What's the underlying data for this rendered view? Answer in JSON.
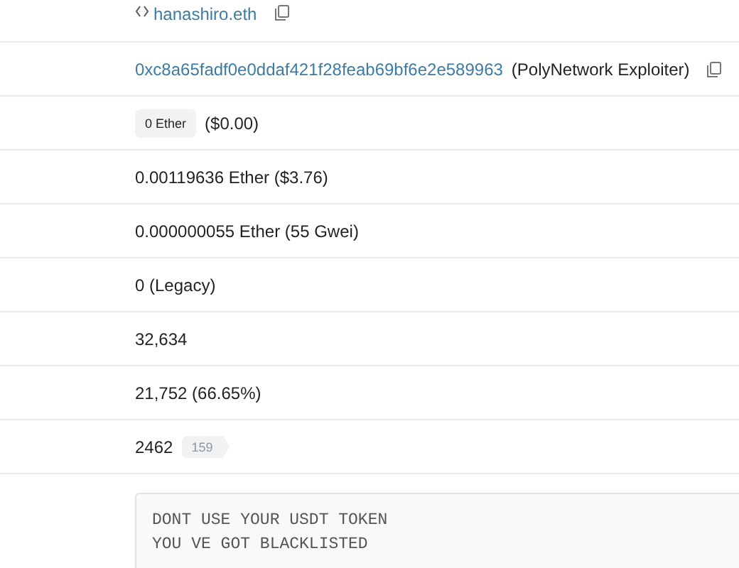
{
  "rows": [
    {
      "kind": "ens",
      "link": "hanashiro.eth"
    },
    {
      "kind": "address",
      "link": "0xc8a65fadf0e0ddaf421f28feab69bf6e2e589963",
      "label": "(PolyNetwork Exploiter)"
    },
    {
      "kind": "value",
      "badge": "0 Ether",
      "text": "($0.00)"
    },
    {
      "kind": "text",
      "text": "0.00119636 Ether ($3.76)"
    },
    {
      "kind": "text",
      "text": "0.000000055 Ether (55 Gwei)"
    },
    {
      "kind": "text",
      "text": "0 (Legacy)"
    },
    {
      "kind": "text",
      "text": "32,634"
    },
    {
      "kind": "text",
      "text": "21,752 (66.65%)"
    },
    {
      "kind": "nonce",
      "text": "2462",
      "badge": "159"
    },
    {
      "kind": "message",
      "lines": [
        "DONT USE YOUR USDT TOKEN",
        "YOU VE GOT BLACKLISTED"
      ]
    }
  ]
}
